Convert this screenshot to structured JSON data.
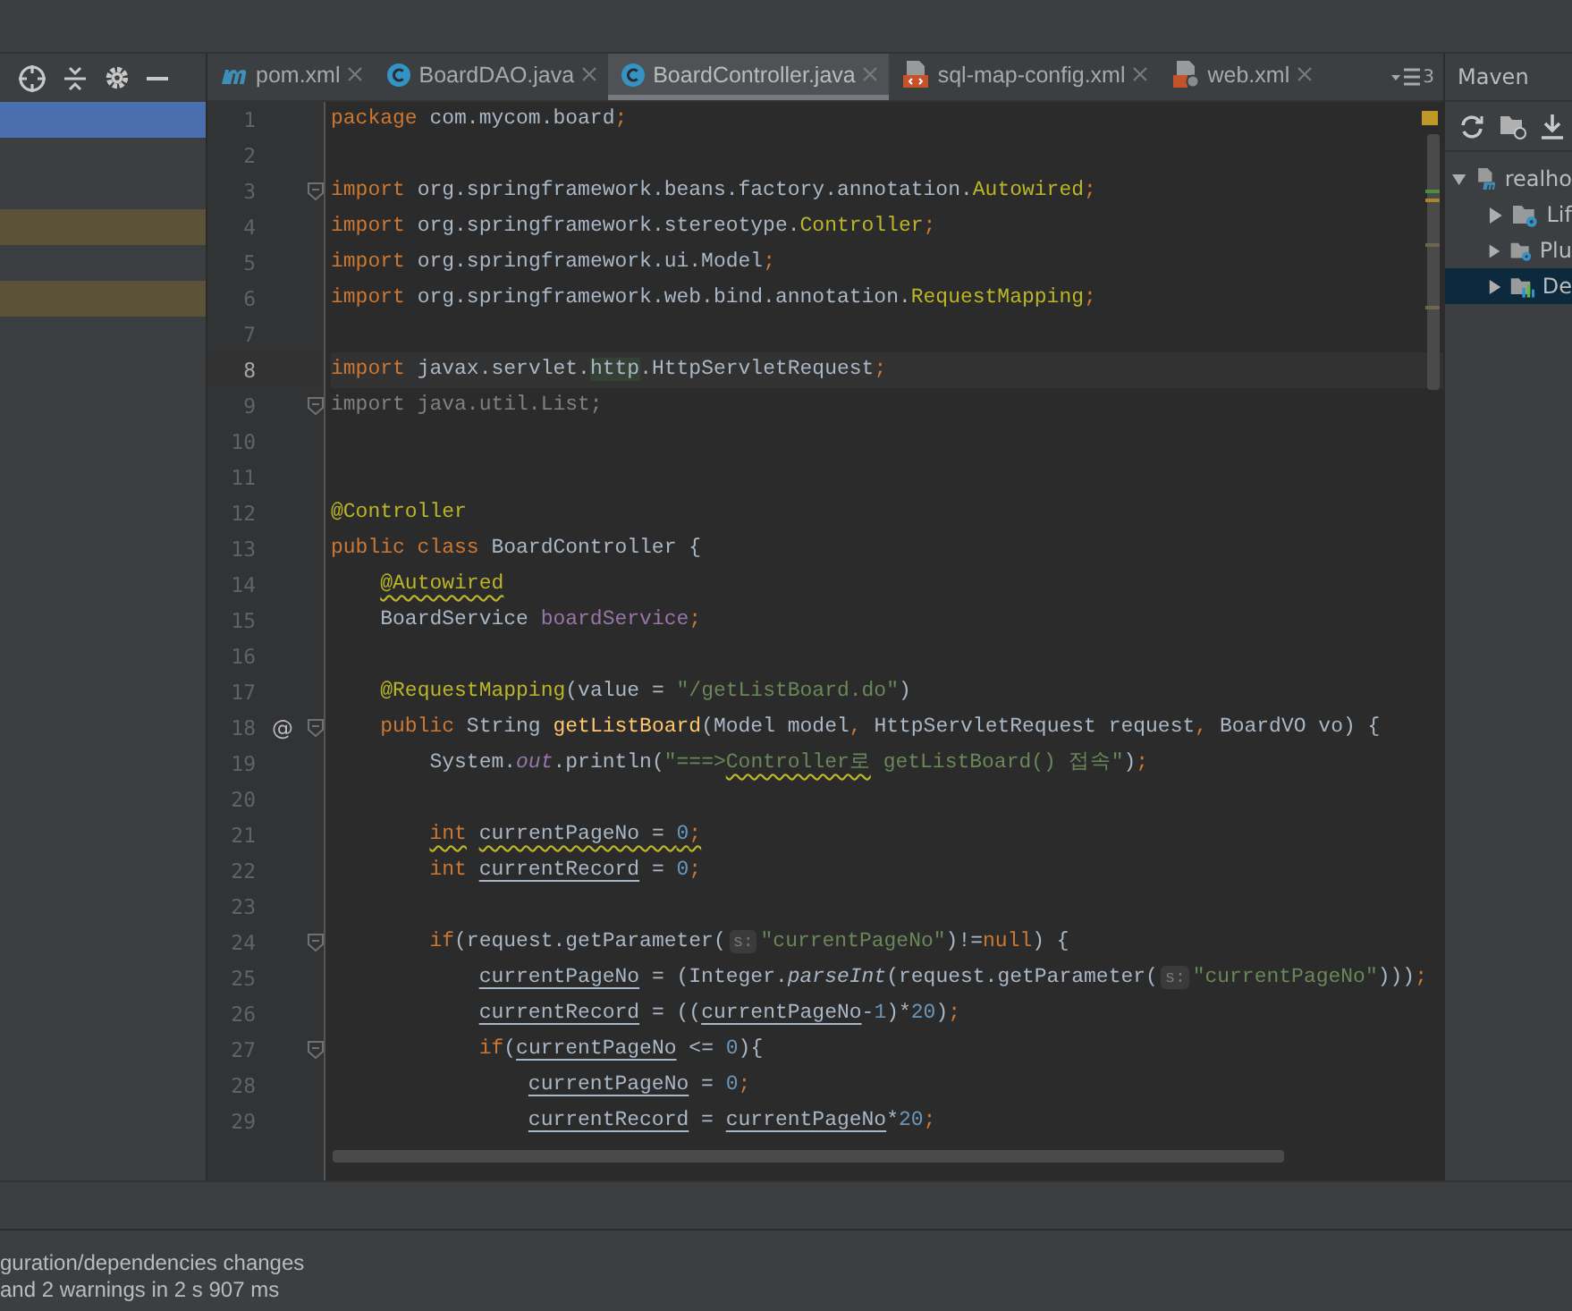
{
  "left_panel": {
    "rows": [
      {
        "selected": true,
        "highlighted": false
      },
      {
        "selected": false,
        "highlighted": false
      },
      {
        "selected": false,
        "highlighted": false
      },
      {
        "selected": false,
        "highlighted": true
      },
      {
        "selected": false,
        "highlighted": false
      },
      {
        "selected": false,
        "highlighted": true
      }
    ]
  },
  "tabs": [
    {
      "label": "pom.xml",
      "kind": "maven",
      "selected": false
    },
    {
      "label": "BoardDAO.java",
      "kind": "class",
      "selected": false
    },
    {
      "label": "BoardController.java",
      "kind": "class",
      "selected": true
    },
    {
      "label": "sql-map-config.xml",
      "kind": "xml",
      "selected": false
    },
    {
      "label": "web.xml",
      "kind": "webxml",
      "selected": false
    }
  ],
  "tab_overflow_count": "3",
  "editor": {
    "lines": [
      {
        "n": "1",
        "current": false,
        "tokens": [
          {
            "kind": "kw",
            "text": "package"
          },
          {
            "kind": "plain",
            "text": " com.mycom.board"
          },
          {
            "kind": "kw",
            "text": ";"
          }
        ]
      },
      {
        "n": "2",
        "current": false
      },
      {
        "n": "3",
        "current": false,
        "fold": true,
        "tokens": [
          {
            "kind": "kw",
            "text": "import"
          },
          {
            "kind": "plain",
            "text": " org.springframework.beans.factory.annotation."
          },
          {
            "kind": "ann",
            "text": "Autowired"
          },
          {
            "kind": "kw",
            "text": ";"
          }
        ]
      },
      {
        "n": "4",
        "current": false,
        "tokens": [
          {
            "kind": "kw",
            "text": "import"
          },
          {
            "kind": "plain",
            "text": " org.springframework.stereotype."
          },
          {
            "kind": "ann",
            "text": "Controller"
          },
          {
            "kind": "kw",
            "text": ";"
          }
        ]
      },
      {
        "n": "5",
        "current": false,
        "tokens": [
          {
            "kind": "kw",
            "text": "import"
          },
          {
            "kind": "plain",
            "text": " org.springframework.ui.Model"
          },
          {
            "kind": "kw",
            "text": ";"
          }
        ]
      },
      {
        "n": "6",
        "current": false,
        "tokens": [
          {
            "kind": "kw",
            "text": "import"
          },
          {
            "kind": "plain",
            "text": " org.springframework.web.bind.annotation."
          },
          {
            "kind": "ann",
            "text": "RequestMapping"
          },
          {
            "kind": "kw",
            "text": ";"
          }
        ]
      },
      {
        "n": "7",
        "current": false
      },
      {
        "n": "8",
        "current": true,
        "tokens": [
          {
            "kind": "kw",
            "text": "import"
          },
          {
            "kind": "plain",
            "text": " javax.servlet."
          },
          {
            "kind": "match",
            "text": "http"
          },
          {
            "kind": "plain",
            "text": ".HttpServletRequest"
          },
          {
            "kind": "kw",
            "text": ";"
          }
        ]
      },
      {
        "n": "9",
        "current": false,
        "fold": true,
        "tokens": [
          {
            "kind": "dim",
            "text": "import java.util.List;"
          }
        ]
      },
      {
        "n": "10",
        "current": false
      },
      {
        "n": "11",
        "current": false
      },
      {
        "n": "12",
        "current": false,
        "tokens": [
          {
            "kind": "ann",
            "text": "@Controller"
          }
        ]
      },
      {
        "n": "13",
        "current": false,
        "tokens": [
          {
            "kind": "kw",
            "text": "public class "
          },
          {
            "kind": "plain",
            "text": "BoardController {"
          }
        ]
      },
      {
        "n": "14",
        "current": false,
        "tokens": [
          {
            "kind": "ann_warn",
            "text": "    @Autowired"
          }
        ]
      },
      {
        "n": "15",
        "current": false,
        "tokens": [
          {
            "kind": "plain",
            "text": "    BoardService "
          },
          {
            "kind": "field",
            "text": "boardService"
          },
          {
            "kind": "kw",
            "text": ";"
          }
        ]
      },
      {
        "n": "16",
        "current": false
      },
      {
        "n": "17",
        "current": false,
        "tokens": [
          {
            "kind": "ann",
            "text": "    @RequestMapping"
          },
          {
            "kind": "plain",
            "text": "(value = "
          },
          {
            "kind": "str",
            "text": "\"/getListBoard.do\""
          },
          {
            "kind": "plain",
            "text": ")"
          }
        ]
      },
      {
        "n": "18",
        "current": false,
        "mark": "@",
        "fold": true,
        "tokens": [
          {
            "kind": "kw",
            "text": "    public "
          },
          {
            "kind": "plain",
            "text": "String "
          },
          {
            "kind": "method",
            "text": "getListBoard"
          },
          {
            "kind": "plain",
            "text": "(Model model"
          },
          {
            "kind": "kw",
            "text": ", "
          },
          {
            "kind": "plain",
            "text": "HttpServletRequest request"
          },
          {
            "kind": "kw",
            "text": ", "
          },
          {
            "kind": "plain",
            "text": "BoardVO vo) {"
          }
        ]
      },
      {
        "n": "19",
        "current": false,
        "tokens": [
          {
            "kind": "plain",
            "text": "        System."
          },
          {
            "kind": "static_field",
            "text": "out"
          },
          {
            "kind": "plain",
            "text": ".println("
          },
          {
            "kind": "str",
            "text": "\"===>"
          },
          {
            "kind": "str_warn",
            "text": "Controller로"
          },
          {
            "kind": "str",
            "text": " getListBoard() 접속\""
          },
          {
            "kind": "plain",
            "text": ")"
          },
          {
            "kind": "kw",
            "text": ";"
          }
        ]
      },
      {
        "n": "20",
        "current": false
      },
      {
        "n": "21",
        "current": false,
        "tokens": [
          {
            "kind": "kw_warn",
            "text": "        int"
          },
          {
            "kind": "plain_warn",
            "text": " currentPageNo = "
          },
          {
            "kind": "num_warn",
            "text": "0"
          },
          {
            "kind": "kw_warn",
            "text": ";"
          }
        ]
      },
      {
        "n": "22",
        "current": false,
        "tokens": [
          {
            "kind": "kw",
            "text": "        int "
          },
          {
            "kind": "var",
            "text": "currentRecord"
          },
          {
            "kind": "plain",
            "text": " = "
          },
          {
            "kind": "num",
            "text": "0"
          },
          {
            "kind": "kw",
            "text": ";"
          }
        ]
      },
      {
        "n": "23",
        "current": false
      },
      {
        "n": "24",
        "current": false,
        "fold": true,
        "tokens": [
          {
            "kind": "kw",
            "text": "        if"
          },
          {
            "kind": "plain",
            "text": "(request.getParameter("
          },
          {
            "kind": "hint",
            "text": "s:"
          },
          {
            "kind": "str",
            "text": "\"currentPageNo\""
          },
          {
            "kind": "plain",
            "text": ")!="
          },
          {
            "kind": "kw",
            "text": "null"
          },
          {
            "kind": "plain",
            "text": ") {"
          }
        ]
      },
      {
        "n": "25",
        "current": false,
        "tokens": [
          {
            "kind": "var",
            "text": "            currentPageNo"
          },
          {
            "kind": "plain",
            "text": " = (Integer."
          },
          {
            "kind": "static_method",
            "text": "parseInt"
          },
          {
            "kind": "plain",
            "text": "(request.getParameter("
          },
          {
            "kind": "hint",
            "text": "s:"
          },
          {
            "kind": "str",
            "text": "\"currentPageNo\""
          },
          {
            "kind": "plain",
            "text": ")))"
          },
          {
            "kind": "kw",
            "text": ";"
          }
        ]
      },
      {
        "n": "26",
        "current": false,
        "tokens": [
          {
            "kind": "var",
            "text": "            currentRecord"
          },
          {
            "kind": "plain",
            "text": " = (("
          },
          {
            "kind": "var",
            "text": "currentPageNo"
          },
          {
            "kind": "plain",
            "text": "-"
          },
          {
            "kind": "num",
            "text": "1"
          },
          {
            "kind": "plain",
            "text": ")*"
          },
          {
            "kind": "num",
            "text": "20"
          },
          {
            "kind": "plain",
            "text": ")"
          },
          {
            "kind": "kw",
            "text": ";"
          }
        ]
      },
      {
        "n": "27",
        "current": false,
        "fold": true,
        "tokens": [
          {
            "kind": "kw",
            "text": "            if"
          },
          {
            "kind": "plain",
            "text": "("
          },
          {
            "kind": "var",
            "text": "currentPageNo"
          },
          {
            "kind": "plain",
            "text": " <= "
          },
          {
            "kind": "num",
            "text": "0"
          },
          {
            "kind": "plain",
            "text": "){"
          }
        ]
      },
      {
        "n": "28",
        "current": false,
        "tokens": [
          {
            "kind": "var",
            "text": "                currentPageNo"
          },
          {
            "kind": "plain",
            "text": " = "
          },
          {
            "kind": "num",
            "text": "0"
          },
          {
            "kind": "kw",
            "text": ";"
          }
        ]
      },
      {
        "n": "29",
        "current": false,
        "tokens": [
          {
            "kind": "var",
            "text": "                currentRecord"
          },
          {
            "kind": "plain",
            "text": " = "
          },
          {
            "kind": "var",
            "text": "currentPageNo"
          },
          {
            "kind": "plain",
            "text": "*"
          },
          {
            "kind": "num",
            "text": "20"
          },
          {
            "kind": "kw",
            "text": ";"
          }
        ]
      }
    ]
  },
  "maven": {
    "title": "Maven",
    "tree": [
      {
        "label": "realho",
        "kind": "module",
        "expanded": true,
        "selected": false,
        "children": [
          {
            "label": "Lif",
            "kind": "gearfolder",
            "expanded": false,
            "selected": false
          },
          {
            "label": "Plu",
            "kind": "gearfolder",
            "expanded": false,
            "selected": false
          },
          {
            "label": "De",
            "kind": "deps",
            "expanded": false,
            "selected": true
          }
        ]
      }
    ]
  },
  "log": [
    "guration/dependencies changes",
    "and 2 warnings in 2 s 907 ms"
  ]
}
